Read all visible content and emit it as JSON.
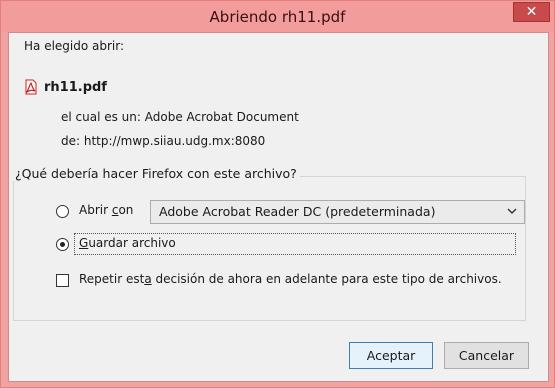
{
  "window": {
    "title": "Abriendo rh11.pdf",
    "close_glyph": "✕"
  },
  "intro_text": "Ha elegido abrir:",
  "file": {
    "icon": "pdf-file-icon",
    "name": "rh11.pdf",
    "type_label": "el cual es un:",
    "type_value": "Adobe Acrobat Document",
    "from_label": "de:",
    "from_value": "http://mwp.siiau.udg.mx:8080"
  },
  "question": {
    "legend": "¿Qué debería hacer Firefox con este archivo?",
    "open_with": {
      "label_pre": "Abrir ",
      "label_access": "c",
      "label_post": "on",
      "selected": false,
      "app_value": "Adobe Acrobat Reader DC  (predeterminada)"
    },
    "save": {
      "label_pre": "",
      "label_access": "G",
      "label_post": "uardar archivo",
      "selected": true
    },
    "remember": {
      "label_pre": "Repetir est",
      "label_access": "a",
      "label_post": " decisión de ahora en adelante para este tipo de archivos.",
      "checked": false
    }
  },
  "buttons": {
    "accept": "Aceptar",
    "cancel": "Cancelar"
  },
  "colors": {
    "titlebar": "#f39c9c",
    "close": "#c94a4a",
    "accent_border": "#3c7fb1"
  }
}
